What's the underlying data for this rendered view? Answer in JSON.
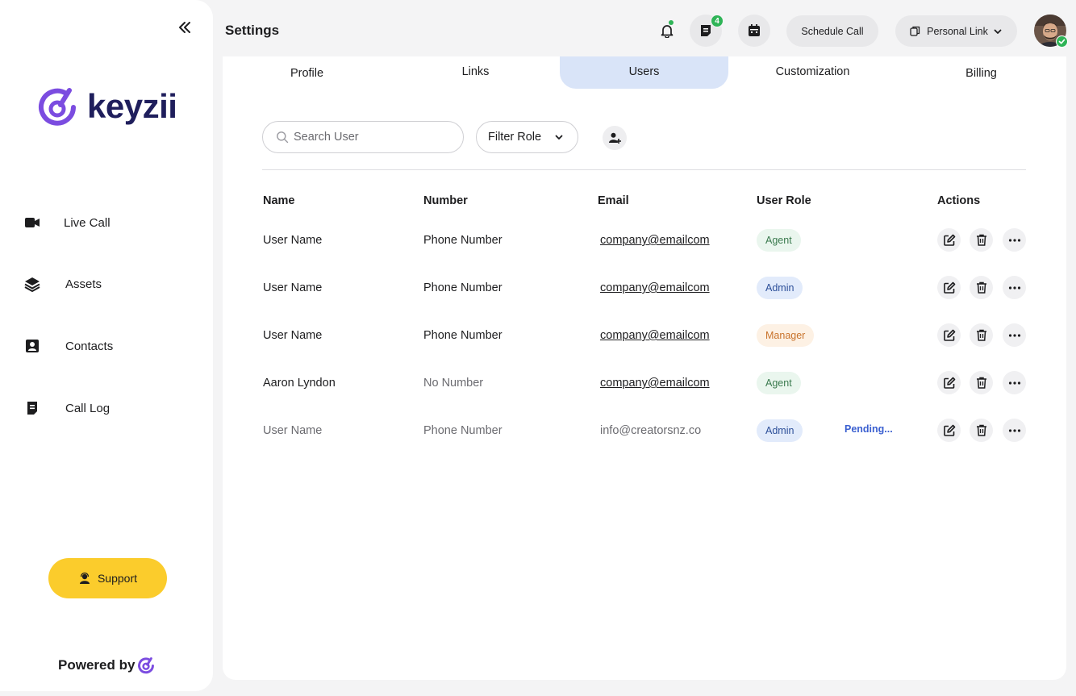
{
  "sidebar": {
    "brand": "keyzii",
    "nav": [
      {
        "label": "Live Call",
        "icon": "video-camera-icon"
      },
      {
        "label": "Assets",
        "icon": "layers-icon"
      },
      {
        "label": "Contacts",
        "icon": "contact-card-icon"
      },
      {
        "label": "Call Log",
        "icon": "notes-icon"
      }
    ],
    "support_label": "Support",
    "powered_by": "Powered by"
  },
  "header": {
    "title": "Settings",
    "messages_count": "4",
    "schedule_label": "Schedule Call",
    "personal_link_label": "Personal Link"
  },
  "tabs": [
    {
      "label": "Profile",
      "active": false
    },
    {
      "label": "Links",
      "active": false
    },
    {
      "label": "Users",
      "active": true
    },
    {
      "label": "Customization",
      "active": false
    },
    {
      "label": "Billing",
      "active": false
    }
  ],
  "toolbar": {
    "search_placeholder": "Search User",
    "filter_label": "Filter Role"
  },
  "table": {
    "headers": {
      "name": "Name",
      "number": "Number",
      "email": "Email",
      "role": "User Role",
      "actions": "Actions"
    },
    "rows": [
      {
        "name": "User Name",
        "number": "Phone Number",
        "email": "company@emailcom",
        "role": "Agent",
        "status": ""
      },
      {
        "name": "User Name",
        "number": "Phone Number",
        "email": "company@emailcom",
        "role": "Admin",
        "status": ""
      },
      {
        "name": "User Name",
        "number": "Phone Number",
        "email": "company@emailcom",
        "role": "Manager",
        "status": ""
      },
      {
        "name": "Aaron Lyndon",
        "number": "No Number",
        "email": "company@emailcom",
        "role": "Agent",
        "status": ""
      },
      {
        "name": "User Name",
        "number": "Phone Number",
        "email": "info@creatorsnz.co",
        "role": "Admin",
        "status": "Pending..."
      }
    ]
  },
  "colors": {
    "brand_purple": "#7b4ce0",
    "brand_navy": "#1f1e5c",
    "support_yellow": "#fbcc2c",
    "active_tab": "#d9e4f8",
    "status_green": "#2fb457",
    "agent_bg": "#eaf6ee",
    "agent_fg": "#3a7a4e",
    "admin_bg": "#e2ebfb",
    "admin_fg": "#2c4f99",
    "manager_bg": "#fdf1e4",
    "manager_fg": "#c9742d",
    "pending_fg": "#3a5fd0"
  }
}
